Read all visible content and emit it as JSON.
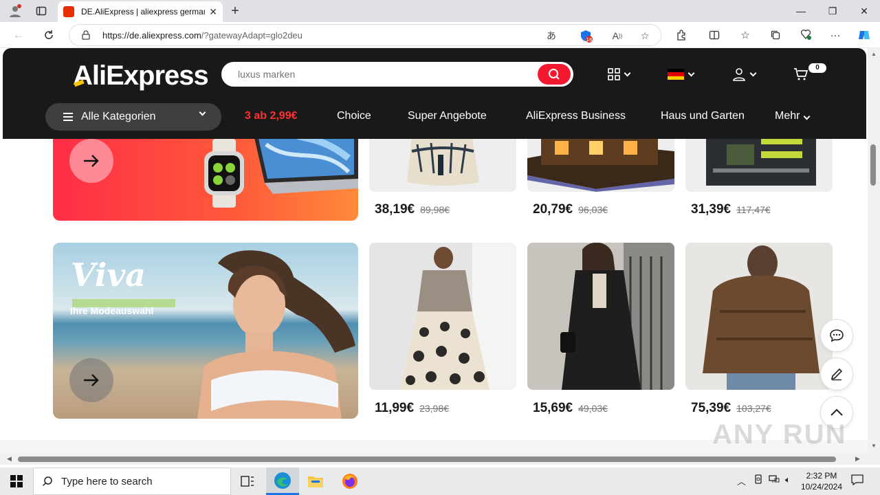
{
  "browser": {
    "tab_title": "DE.AliExpress | aliexpress german",
    "url_host": "https://de.aliexpress.com",
    "url_path": "/?gatewayAdapt=glo2deu",
    "badge_count": "16"
  },
  "header": {
    "logo": "AliExpress",
    "search_placeholder": "luxus marken",
    "cart_count": "0",
    "categories_label": "Alle Kategorien",
    "nav": [
      {
        "label": "3 ab 2,99€"
      },
      {
        "label": "Choice"
      },
      {
        "label": "Super Angebote"
      },
      {
        "label": "AliExpress Business"
      },
      {
        "label": "Haus und Garten"
      },
      {
        "label": "Mehr"
      }
    ]
  },
  "promo2": {
    "title": "Viva",
    "subtitle": "Ihre Modeauswahl"
  },
  "products_row1": [
    {
      "price": "38,19€",
      "old_price": "89,98€"
    },
    {
      "price": "20,79€",
      "old_price": "96,03€"
    },
    {
      "price": "31,39€",
      "old_price": "117,47€"
    }
  ],
  "products_row2": [
    {
      "price": "11,99€",
      "old_price": "23,98€"
    },
    {
      "price": "15,69€",
      "old_price": "49,03€"
    },
    {
      "price": "75,39€",
      "old_price": "103,27€"
    }
  ],
  "watermark": "ANY RUN",
  "taskbar": {
    "search_text": "Type here to search",
    "time": "2:32 PM",
    "date": "10/24/2024"
  },
  "colors": {
    "brand_red": "#f5192f",
    "header_bg": "#191919",
    "hot_deal": "#ff3131"
  }
}
